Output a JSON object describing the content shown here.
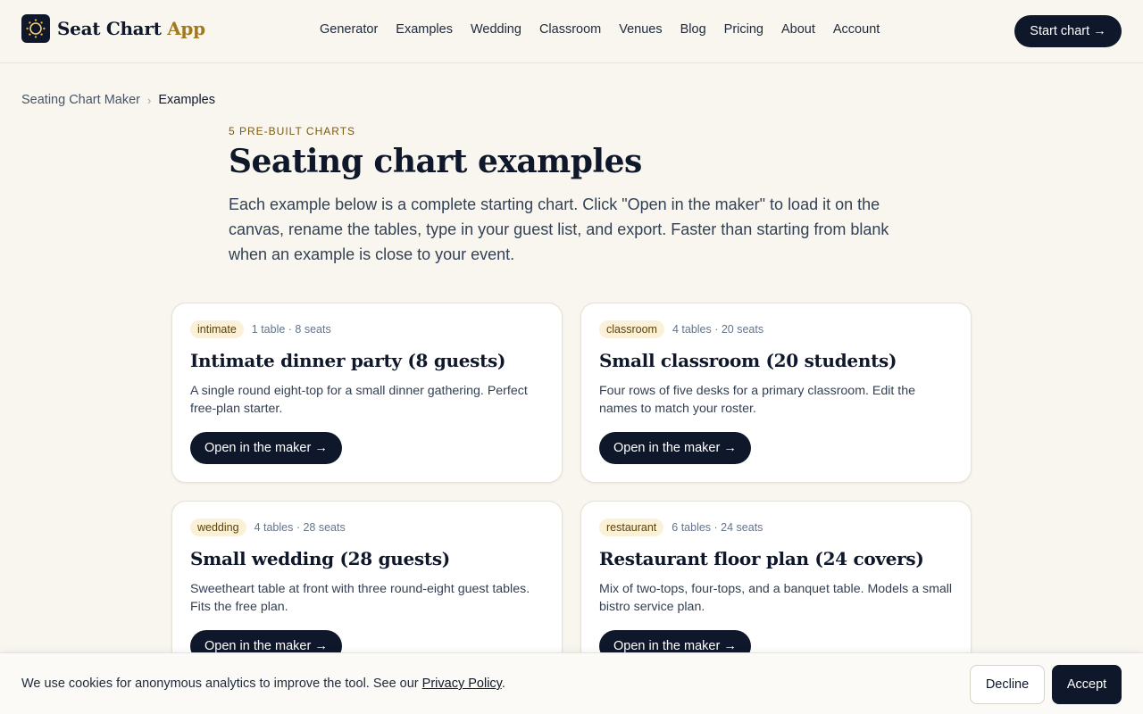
{
  "brand": {
    "name": "Seat Chart",
    "accent_word": "App",
    "logo_icon": "sun-logo-icon"
  },
  "nav": {
    "items": [
      "Generator",
      "Examples",
      "Wedding",
      "Classroom",
      "Venues",
      "Blog",
      "Pricing",
      "About",
      "Account"
    ],
    "cta_label": "Start chart →"
  },
  "breadcrumb": {
    "parent": "Seating Chart Maker",
    "separator": "›",
    "current": "Examples"
  },
  "intro": {
    "eyebrow": "5 PRE-BUILT CHARTS",
    "title": "Seating chart examples",
    "body": "Each example below is a complete starting chart. Click \"Open in the maker\" to load it on the canvas, rename the tables, type in your guest list, and export. Faster than starting from blank when an example is close to your event."
  },
  "cards": [
    {
      "tag": "intimate",
      "count": "1 table · 8 seats",
      "title": "Intimate dinner party (8 guests)",
      "desc": "A single round eight-top for a small dinner gathering. Perfect free-plan starter.",
      "button": "Open in the maker →"
    },
    {
      "tag": "classroom",
      "count": "4 tables · 20 seats",
      "title": "Small classroom (20 students)",
      "desc": "Four rows of five desks for a primary classroom. Edit the names to match your roster.",
      "button": "Open in the maker →"
    },
    {
      "tag": "wedding",
      "count": "4 tables · 28 seats",
      "title": "Small wedding (28 guests)",
      "desc": "Sweetheart table at front with three round-eight guest tables. Fits the free plan.",
      "button": "Open in the maker →"
    },
    {
      "tag": "restaurant",
      "count": "6 tables · 24 seats",
      "title": "Restaurant floor plan (24 covers)",
      "desc": "Mix of two-tops, four-tops, and a banquet table. Models a small bistro service plan.",
      "button": "Open in the maker →"
    }
  ],
  "cookie": {
    "text": "We use cookies for anonymous analytics to improve the tool. See our",
    "link": "Privacy Policy",
    "period": ".",
    "decline": "Decline",
    "accept": "Accept"
  },
  "colors": {
    "brand_dark": "#0f172a",
    "accent_gold": "#a07a1f",
    "tag_bg": "#fbf1d9",
    "page_bg": "#f8f6ef"
  }
}
